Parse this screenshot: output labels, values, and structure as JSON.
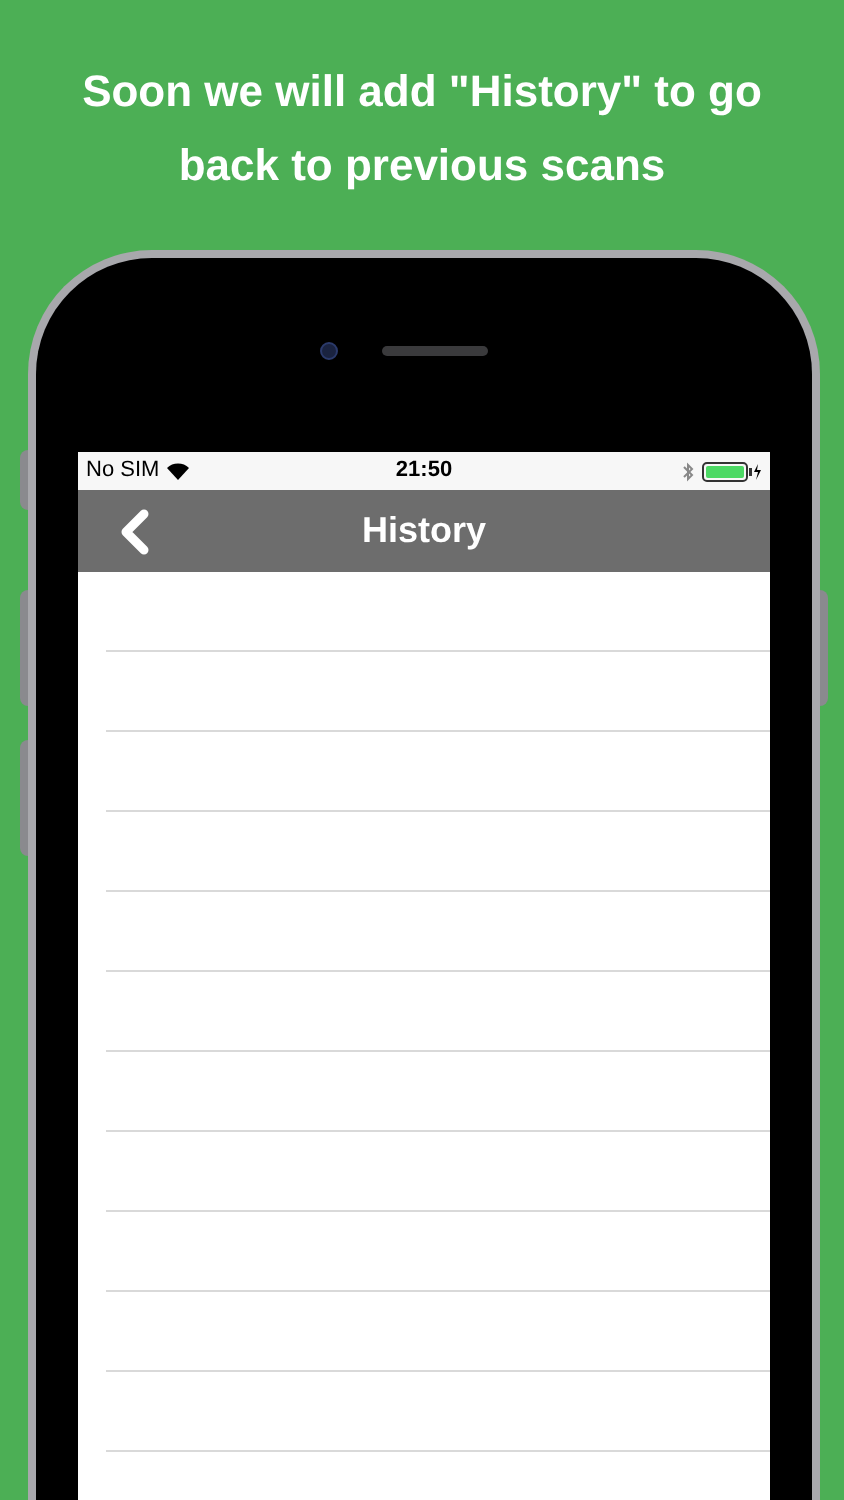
{
  "headline": "Soon we will add \"History\" to go back to previous scans",
  "status_bar": {
    "carrier": "No SIM",
    "time": "21:50"
  },
  "nav_bar": {
    "title": "History"
  }
}
